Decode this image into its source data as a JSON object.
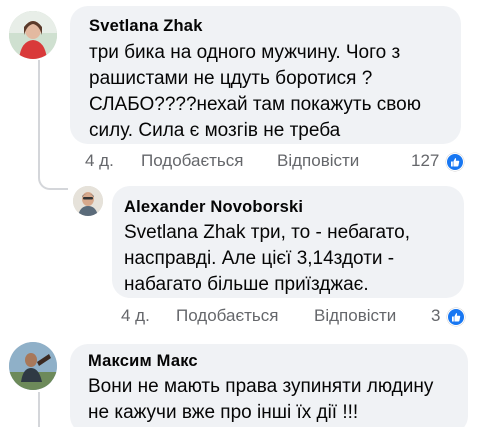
{
  "comments": [
    {
      "author": "Svetlana Zhak",
      "lines": [
        "три бика на одного мужчину. Чого з",
        "рашистами не цдуть боротися ?",
        "СЛАБО????нехай там покажуть свою",
        "силу. Сила є мозгів не треба"
      ],
      "age": "4 д.",
      "like_label": "Подобається",
      "reply_label": "Відповісти",
      "reaction_count": "127",
      "reaction_icon": "like-icon"
    },
    {
      "author": "Alexander Novoborski",
      "lines": [
        "Svetlana Zhak  три, то - небагато,",
        "насправді. Але цієї 3,14здоти -",
        "набагато більше приїзджає."
      ],
      "age": "4 д.",
      "like_label": "Подобається",
      "reply_label": "Відповісти",
      "reaction_count": "3",
      "reaction_icon": "like-icon"
    },
    {
      "author": "Максим Макс",
      "lines": [
        "Вони не мають права зупиняти людину",
        "не кажучи вже про інші їх дії !!!"
      ]
    }
  ],
  "colors": {
    "bubble": "#f0f2f5",
    "meta_text": "#65676b",
    "like_blue": "#1877f2",
    "thread_line": "#d4d6da"
  }
}
